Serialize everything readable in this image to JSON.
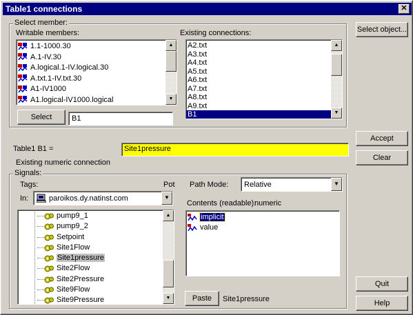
{
  "window": {
    "title": "Table1 connections",
    "close_glyph": "✕"
  },
  "select_member": {
    "group_label": "Select member:",
    "writable_label": "Writable members:",
    "writable_items": [
      "1.1-1000.30",
      "A.1-IV.30",
      "A.logical.1-IV.logical.30",
      "A.txt.1-IV.txt.30",
      "A1-IV1000",
      "A1.logical-IV1000.logical"
    ],
    "existing_label": "Existing connections:",
    "existing_items": [
      "A2.txt",
      "A3.txt",
      "A4.txt",
      "A5.txt",
      "A6.txt",
      "A7.txt",
      "A8.txt",
      "A9.txt",
      "B1"
    ],
    "existing_selected": "B1",
    "select_button": "Select",
    "member_value": "B1"
  },
  "buttons": {
    "select_object": "Select object...",
    "accept": "Accept",
    "clear": "Clear",
    "quit": "Quit",
    "help": "Help",
    "paste": "Paste"
  },
  "connection": {
    "name_label": "Table1 B1 =",
    "value": "Site1pressure",
    "status": "Existing numeric connection"
  },
  "signals": {
    "group_label": "Signals:",
    "tags_label": "Tags:",
    "pot_label": "Pot",
    "in_label": "In:",
    "server": "paroikos.dy.natinst.com",
    "tree_items": [
      "pump9_1",
      "pump9_2",
      "Setpoint",
      "Site1Flow",
      "Site1pressure",
      "Site2Flow",
      "Site2Pressure",
      "Site9Flow",
      "Site9Pressure"
    ],
    "tree_selected": "Site1pressure",
    "path_mode_label": "Path Mode:",
    "path_mode_value": "Relative",
    "contents_label": "Contents (readable):",
    "contents_type": "numeric",
    "contents_items": [
      "implicit",
      "value"
    ],
    "paste_value": "Site1pressure"
  },
  "colors": {
    "titlebar": "#000080",
    "selection": "#000080",
    "value_highlight": "#ffff00",
    "face": "#d4d0c8"
  },
  "icons": {
    "member_icon": "member-icon",
    "tag_icon": "gear-icon",
    "server_icon": "computer-icon",
    "content_icon": "wave-icon"
  }
}
